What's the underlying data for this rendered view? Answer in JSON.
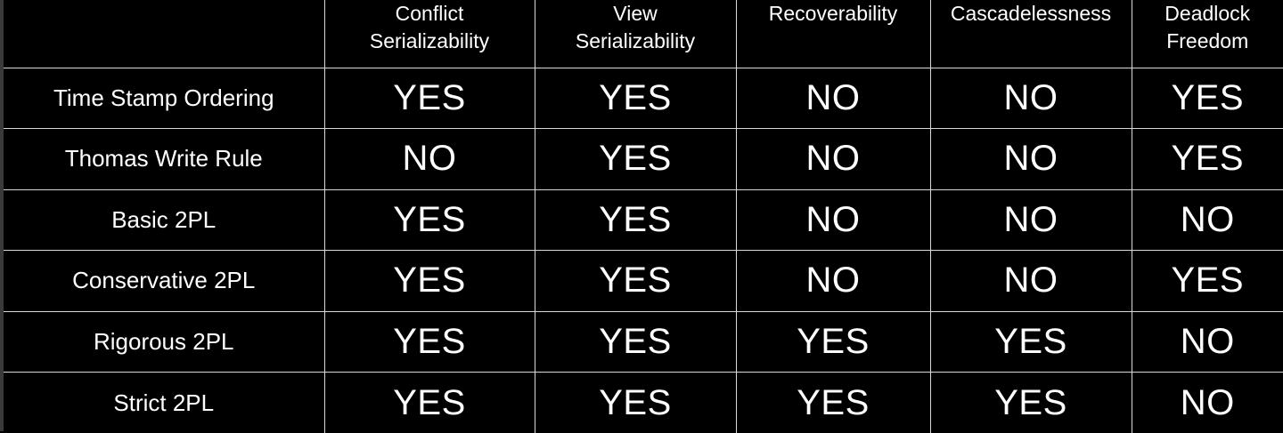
{
  "table": {
    "columns": [
      {
        "line1": "Conflict",
        "line2": "Serializability"
      },
      {
        "line1": "View",
        "line2": "Serializability"
      },
      {
        "line1": "Recoverability",
        "line2": ""
      },
      {
        "line1": "Cascadelessness",
        "line2": ""
      },
      {
        "line1": "Deadlock",
        "line2": "Freedom"
      }
    ],
    "rows": [
      {
        "label": "Time Stamp Ordering",
        "values": [
          "YES",
          "YES",
          "NO",
          "NO",
          "YES"
        ]
      },
      {
        "label": "Thomas Write Rule",
        "values": [
          "NO",
          "YES",
          "NO",
          "NO",
          "YES"
        ]
      },
      {
        "label": "Basic 2PL",
        "values": [
          "YES",
          "YES",
          "NO",
          "NO",
          "NO"
        ]
      },
      {
        "label": "Conservative 2PL",
        "values": [
          "YES",
          "YES",
          "NO",
          "NO",
          "YES"
        ]
      },
      {
        "label": "Rigorous 2PL",
        "values": [
          "YES",
          "YES",
          "YES",
          "YES",
          "NO"
        ]
      },
      {
        "label": "Strict 2PL",
        "values": [
          "YES",
          "YES",
          "YES",
          "YES",
          "NO"
        ]
      }
    ]
  },
  "colors": {
    "background": "#000000",
    "text": "#ffffff",
    "grid_lines": "#d9d9d9"
  }
}
